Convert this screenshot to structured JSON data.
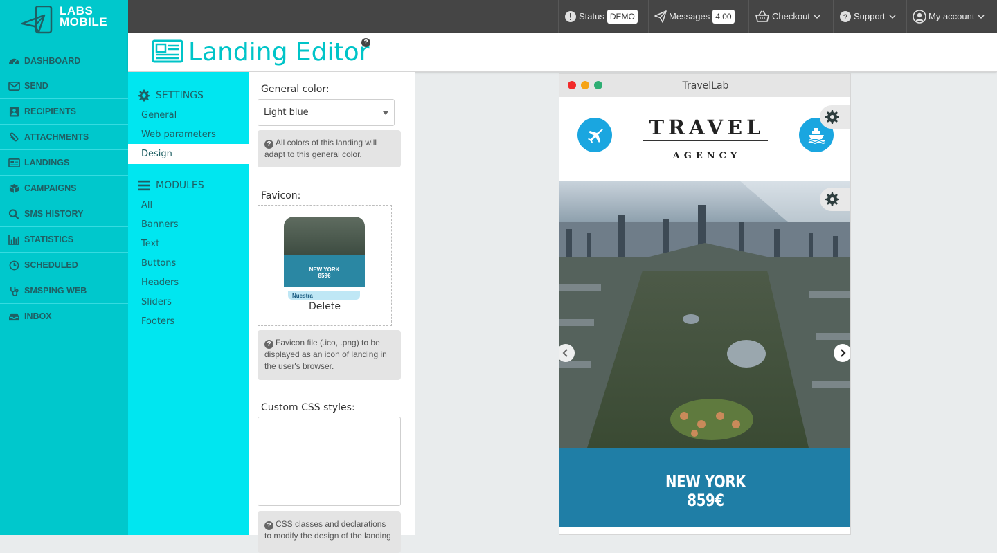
{
  "logo": {
    "line1": "LABS",
    "line2": "MOBILE"
  },
  "nav": [
    {
      "label": "DASHBOARD",
      "icon": "dashboard-icon"
    },
    {
      "label": "SEND",
      "icon": "envelope-icon"
    },
    {
      "label": "RECIPIENTS",
      "icon": "contact-card-icon"
    },
    {
      "label": "ATTACHMENTS",
      "icon": "paperclip-icon"
    },
    {
      "label": "LANDINGS",
      "icon": "newspaper-icon"
    },
    {
      "label": "CAMPAIGNS",
      "icon": "cube-icon"
    },
    {
      "label": "SMS HISTORY",
      "icon": "search-icon"
    },
    {
      "label": "STATISTICS",
      "icon": "bar-chart-icon"
    },
    {
      "label": "SCHEDULED",
      "icon": "clock-icon"
    },
    {
      "label": "SMSPING WEB",
      "icon": "stethoscope-icon"
    },
    {
      "label": "INBOX",
      "icon": "inbox-icon"
    }
  ],
  "topbar": {
    "status_label": "Status",
    "status_badge": "DEMO",
    "messages_label": "Messages",
    "messages_badge": "4.00",
    "checkout_label": "Checkout",
    "support_label": "Support",
    "account_label": "My account"
  },
  "header": {
    "title": "Landing Editor",
    "help": "?"
  },
  "subpanel": {
    "settings_heading": "SETTINGS",
    "settings_items": [
      "General",
      "Web parameters",
      "Design"
    ],
    "active_item": "Design",
    "modules_heading": "MODULES",
    "modules_items": [
      "All",
      "Banners",
      "Text",
      "Buttons",
      "Headers",
      "Sliders",
      "Footers"
    ]
  },
  "form": {
    "general_color_label": "General color:",
    "general_color_value": "Light blue",
    "general_color_help": "All colors of this landing will adapt to this general color.",
    "favicon_label": "Favicon:",
    "favicon_thumb_text1": "NEW YORK",
    "favicon_thumb_text2": "859€",
    "favicon_thumb_footer": "Nuestra",
    "favicon_delete": "Delete",
    "favicon_help": "Favicon file (.ico, .png) to be displayed as an icon of landing in the user's browser.",
    "css_label": "Custom CSS styles:",
    "css_value": "",
    "css_help": "CSS classes and declarations to modify the design of the landing"
  },
  "preview": {
    "window_title": "TravelLab",
    "brand_main": "TRAVEL",
    "brand_sub": "AGENCY",
    "banner_line1": "NEW YORK",
    "banner_line2": "859€"
  },
  "colors": {
    "sidebar": "#00c8cc",
    "subpanel": "#00e6f0",
    "accent": "#00c4c8",
    "topbar": "#454545",
    "banner": "#1f7ea6",
    "icon_circle": "#1aa6e0"
  }
}
